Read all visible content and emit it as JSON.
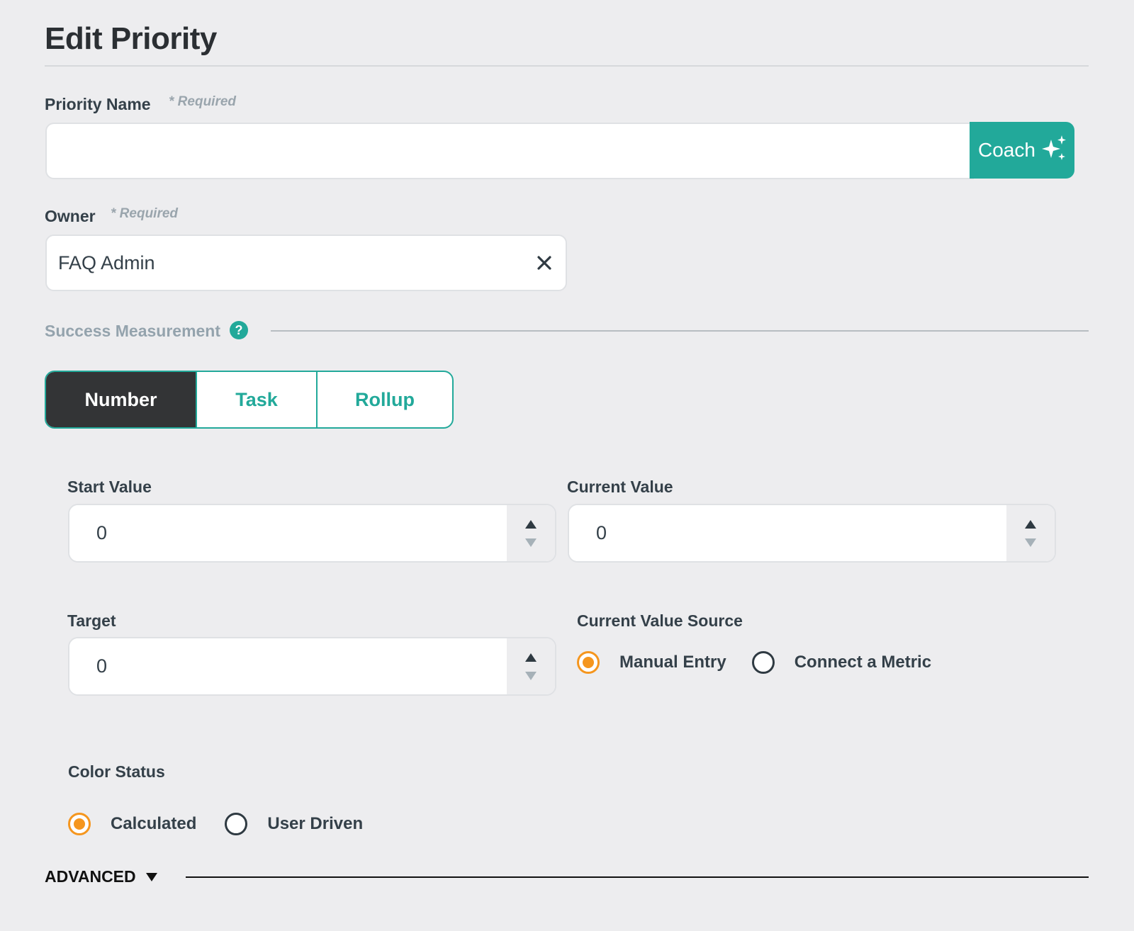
{
  "page": {
    "title": "Edit Priority"
  },
  "priority_name": {
    "label": "Priority Name",
    "required": "* Required",
    "value": "",
    "coach_label": "Coach"
  },
  "owner": {
    "label": "Owner",
    "required": "* Required",
    "value": "FAQ Admin",
    "clear_icon": "close-icon"
  },
  "success": {
    "label": "Success Measurement",
    "help_glyph": "?",
    "tabs": [
      {
        "label": "Number",
        "active": true
      },
      {
        "label": "Task",
        "active": false
      },
      {
        "label": "Rollup",
        "active": false
      }
    ]
  },
  "number": {
    "start": {
      "label": "Start Value",
      "value": "0"
    },
    "current": {
      "label": "Current Value",
      "value": "0"
    },
    "target": {
      "label": "Target",
      "value": "0"
    }
  },
  "current_value_source": {
    "label": "Current Value Source",
    "options": [
      {
        "label": "Manual Entry",
        "checked": true
      },
      {
        "label": "Connect a Metric",
        "checked": false
      }
    ]
  },
  "color_status": {
    "label": "Color Status",
    "options": [
      {
        "label": "Calculated",
        "checked": true
      },
      {
        "label": "User Driven",
        "checked": false
      }
    ]
  },
  "advanced": {
    "label": "ADVANCED"
  },
  "colors": {
    "accent": "#22a99a",
    "radio_checked": "#f5961e",
    "active_tab": "#333436"
  }
}
